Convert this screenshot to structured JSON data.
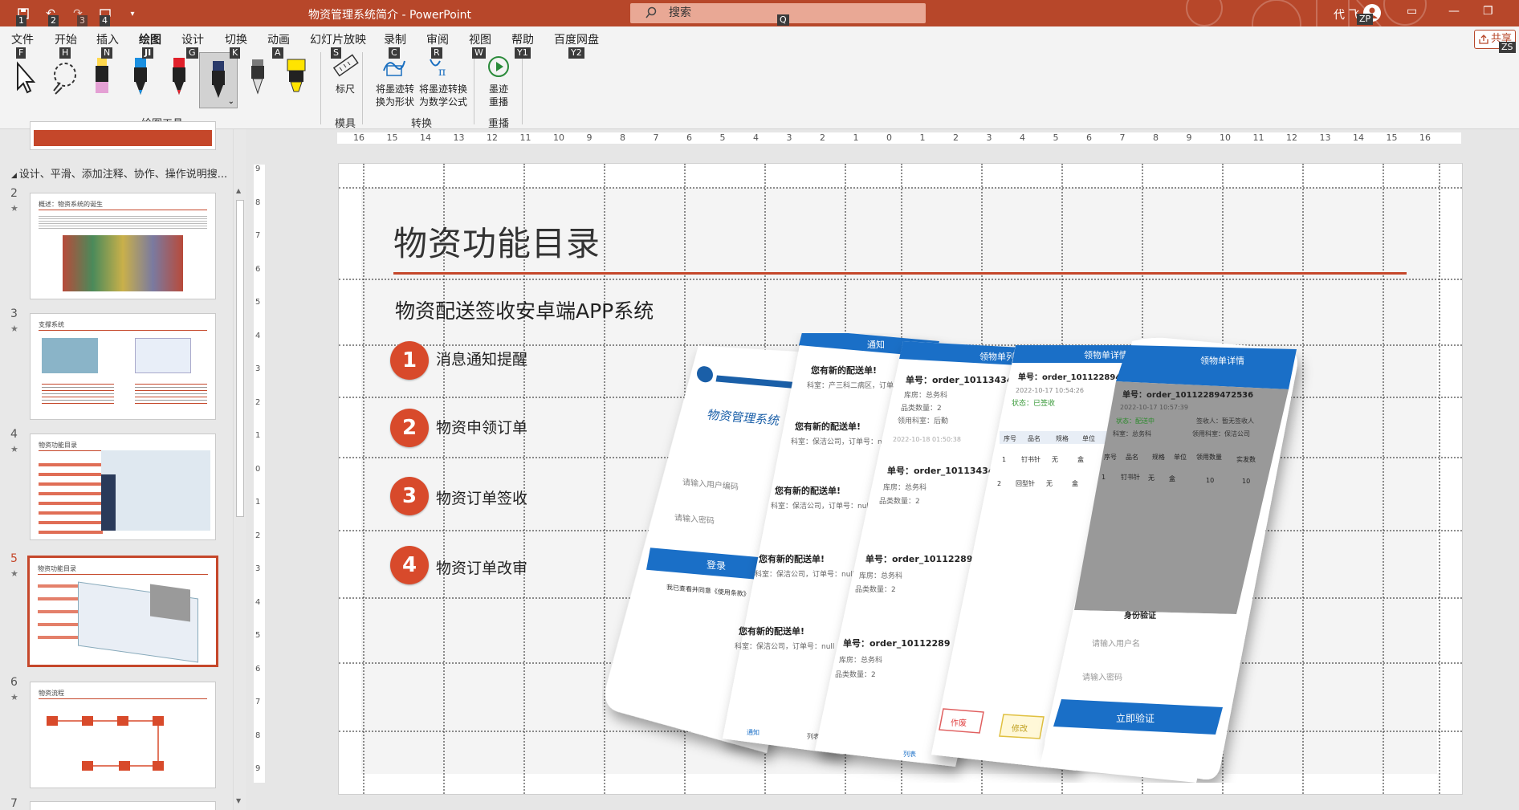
{
  "window": {
    "doc_title": "物资管理系统简介 - PowerPoint",
    "search_placeholder": "搜索",
    "user": "代 飞",
    "user_initials_tip": "ZP"
  },
  "quick_access_keytips": [
    "1",
    "2",
    "3",
    "4"
  ],
  "ribbon": {
    "tabs": [
      {
        "label": "文件",
        "key": "F"
      },
      {
        "label": "开始",
        "key": "H"
      },
      {
        "label": "插入",
        "key": "N"
      },
      {
        "label": "绘图",
        "key": "JI"
      },
      {
        "label": "设计",
        "key": "G"
      },
      {
        "label": "切换",
        "key": "K"
      },
      {
        "label": "动画",
        "key": "A"
      },
      {
        "label": "幻灯片放映",
        "key": "S"
      },
      {
        "label": "录制",
        "key": "C"
      },
      {
        "label": "审阅",
        "key": "R"
      },
      {
        "label": "视图",
        "key": "W"
      },
      {
        "label": "帮助",
        "key": "Y1"
      },
      {
        "label": "百度网盘",
        "key": "Y2"
      }
    ],
    "search_key": "Q",
    "share_label": "共享",
    "share_key": "ZS",
    "groups": {
      "drawing_tools": "绘图工具",
      "stencils": "模具",
      "convert": "转换",
      "replay": "重播"
    },
    "commands": {
      "ruler": "标尺",
      "ink_to_shape": "将墨迹转换为形状",
      "ink_to_math": "将墨迹转换为数学公式",
      "ink_replay": "墨迹重播"
    },
    "pen_colors": [
      "#e4a0d4",
      "#1a8fe0",
      "#e0202a",
      "#2a3a6a",
      "#7a7a7a",
      "#ffe400"
    ]
  },
  "slides_panel": {
    "section": "设计、平滑、添加注释、协作、操作说明搜...",
    "thumbnails": [
      {
        "num": "2",
        "title": "概述：物资系统的诞生"
      },
      {
        "num": "3",
        "title": "支撑系统"
      },
      {
        "num": "4",
        "title": "物资功能目录"
      },
      {
        "num": "5",
        "title": "物资功能目录",
        "selected": true
      },
      {
        "num": "6",
        "title": "物资流程"
      },
      {
        "num": "7",
        "title": ""
      }
    ]
  },
  "rulers": {
    "h_ticks": [
      "16",
      "15",
      "14",
      "13",
      "12",
      "11",
      "10",
      "9",
      "8",
      "7",
      "6",
      "5",
      "4",
      "3",
      "2",
      "1",
      "0",
      "1",
      "2",
      "3",
      "4",
      "5",
      "6",
      "7",
      "8",
      "9",
      "10",
      "11",
      "12",
      "13",
      "14",
      "15",
      "16"
    ],
    "v_ticks": [
      "9",
      "8",
      "7",
      "6",
      "5",
      "4",
      "3",
      "2",
      "1",
      "0",
      "1",
      "2",
      "3",
      "4",
      "5",
      "6",
      "7",
      "8",
      "9"
    ]
  },
  "slide": {
    "title": "物资功能目录",
    "subtitle": "物资配送签收安卓端APP系统",
    "accent": "#c5472a",
    "items": [
      {
        "num": "1",
        "label": "消息通知提醒"
      },
      {
        "num": "2",
        "label": "物资申领订单"
      },
      {
        "num": "3",
        "label": "物资订单签收"
      },
      {
        "num": "4",
        "label": "物资订单改审"
      }
    ],
    "phones": {
      "login": {
        "system_name": "物资管理系统",
        "user_placeholder": "请输入用户编码",
        "password_placeholder": "请输入密码",
        "login_button": "登录",
        "agree": "我已查看并同意《使用条款》"
      },
      "notify": {
        "header": "通知",
        "items": [
          "您有新的配送单!",
          "您有新的配送单!",
          "您有新的配送单!",
          "您有新的配送单!",
          "您有新的配送单!"
        ],
        "detail": "科室：产三科二病区，订单号：",
        "detail2": "科室：保洁公司，订单号：null",
        "tab_notify": "通知",
        "tab_list": "列表"
      },
      "order_list": {
        "header": "领物单列表",
        "orders": [
          "单号：order_10113434255",
          "单号：order_1011343425",
          "单号：order_101122894",
          "单号：order_10112289"
        ],
        "lines": [
          "库房：总务科",
          "品类数量：2",
          "领用科室：后勤",
          "2022-10-18 01:50:38"
        ],
        "tab_list": "列表"
      },
      "order_detail": {
        "header": "领物单详情",
        "order": "单号：order_101122894725",
        "date": "2022-10-17 10:54:26",
        "status": "状态：已签收",
        "cols": [
          "序号",
          "品名",
          "规格",
          "单位"
        ],
        "rows": [
          [
            "1",
            "钉书针",
            "无",
            "盒"
          ],
          [
            "2",
            "回型针",
            "无",
            "盒"
          ]
        ],
        "reject": "作废",
        "modify": "修改"
      },
      "verify": {
        "header": "领物单详情",
        "order": "单号：order_10112289472536",
        "date": "2022-10-17 10:57:39",
        "status": "状态：配送中",
        "receiver": "签收人：暂无签收人",
        "dept": "科室：总务科",
        "dept2": "领用科室：保洁公司",
        "cols": [
          "序号",
          "品名",
          "规格",
          "单位",
          "领用数量",
          "实发数"
        ],
        "row": [
          "1",
          "钉书针",
          "无",
          "盒",
          "10",
          "10"
        ],
        "dialog_title": "身份验证",
        "user_placeholder": "请输入用户名",
        "password_placeholder": "请输入密码",
        "verify_button": "立即验证"
      }
    }
  }
}
